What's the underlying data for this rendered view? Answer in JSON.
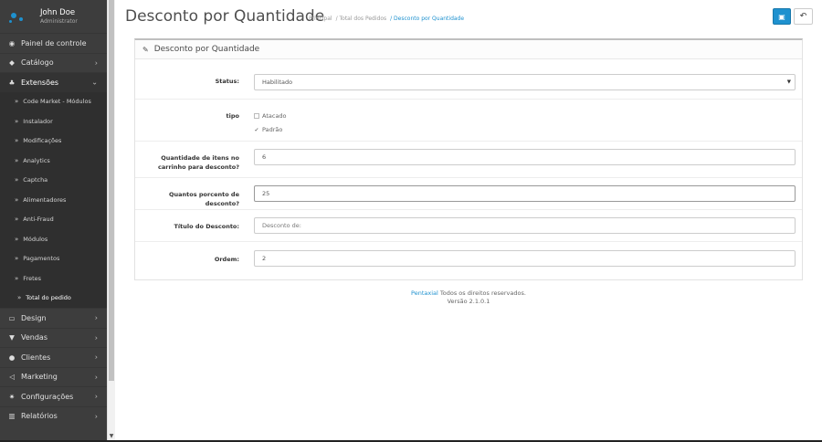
{
  "user": {
    "name": "John Doe",
    "role": "Administrator"
  },
  "menu": [
    {
      "label": "Painel de controle",
      "icon": "dashboard-icon",
      "glyph": "◉",
      "chevron": ""
    },
    {
      "label": "Catálogo",
      "icon": "tag-icon",
      "glyph": "◆",
      "chevron": "›"
    },
    {
      "label": "Extensões",
      "icon": "puzzle-icon",
      "glyph": "♣",
      "chevron": "⌄"
    }
  ],
  "submenu": [
    {
      "label": "Code Market - Módulos"
    },
    {
      "label": "Instalador"
    },
    {
      "label": "Modificações"
    },
    {
      "label": "Analytics"
    },
    {
      "label": "Captcha"
    },
    {
      "label": "Alimentadores"
    },
    {
      "label": "Anti-Fraud"
    },
    {
      "label": "Módulos"
    },
    {
      "label": "Pagamentos"
    },
    {
      "label": "Fretes"
    },
    {
      "label": "Total do pedido"
    }
  ],
  "menu_bottom": [
    {
      "label": "Design",
      "icon": "monitor-icon",
      "glyph": "▭"
    },
    {
      "label": "Vendas",
      "icon": "cart-icon",
      "glyph": "▼"
    },
    {
      "label": "Clientes",
      "icon": "user-icon",
      "glyph": "●"
    },
    {
      "label": "Marketing",
      "icon": "share-icon",
      "glyph": "◁"
    },
    {
      "label": "Configurações",
      "icon": "gear-icon",
      "glyph": "✷"
    },
    {
      "label": "Relatórios",
      "icon": "bar-chart-icon",
      "glyph": "▥"
    }
  ],
  "header": {
    "title": "Desconto por Quantidade",
    "breadcrumb": [
      "Principal",
      "/ Total dos Pedidos",
      "/ Desconto por Quantidade"
    ]
  },
  "panel": {
    "title": "Desconto por Quantidade"
  },
  "form": {
    "status": {
      "label": "Status:",
      "value": "Habilitado"
    },
    "tipo": {
      "label": "tipo",
      "options": [
        "Atacado",
        "Padrão"
      ],
      "checked": "Padrão"
    },
    "quantidade": {
      "label": "Quantidade de itens no carrinho para desconto?",
      "value": "6"
    },
    "porcento": {
      "label": "Quantos porcento de desconto?",
      "value": "25"
    },
    "titulo": {
      "label": "Título do Desconto:",
      "placeholder": "Desconto de:"
    },
    "ordem": {
      "label": "Ordem:",
      "value": "2"
    }
  },
  "footer": {
    "brand": "Pentaxial",
    "rights": " Todos os direitos reservados.",
    "version": "Versão 2.1.0.1"
  },
  "colors": {
    "accent": "#1e91cf",
    "sidebar": "#3d3d3d"
  }
}
